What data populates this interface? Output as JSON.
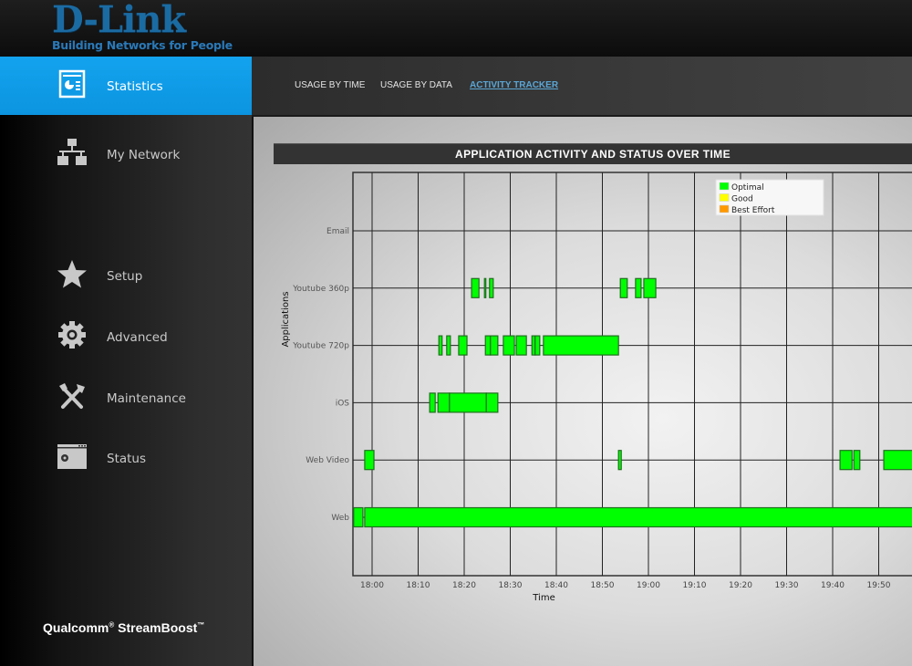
{
  "header": {
    "logo_text": "D-Link",
    "tagline": "Building Networks for People"
  },
  "sidebar": {
    "items": [
      {
        "label": "Statistics",
        "icon": "statistics-icon",
        "active": true
      },
      {
        "label": "My Network",
        "icon": "network-icon",
        "active": false
      },
      {
        "label": "Setup",
        "icon": "star-icon",
        "active": false
      },
      {
        "label": "Advanced",
        "icon": "gear-icon",
        "active": false
      },
      {
        "label": "Maintenance",
        "icon": "tools-icon",
        "active": false
      },
      {
        "label": "Status",
        "icon": "status-window-icon",
        "active": false
      }
    ],
    "brand": {
      "name1": "Qualcomm",
      "reg": "®",
      "name2": " StreamBoost",
      "tm": "™"
    }
  },
  "subnav": {
    "tabs": [
      {
        "label": "USAGE BY TIME",
        "active": false
      },
      {
        "label": "USAGE BY DATA",
        "active": false
      },
      {
        "label": "ACTIVITY TRACKER",
        "active": true
      }
    ]
  },
  "colors": {
    "optimal": "#00ff00",
    "good": "#ffff00",
    "best_effort": "#ff9900",
    "accent": "#0c9de6"
  },
  "chart_data": {
    "type": "timeline",
    "title": "APPLICATION ACTIVITY AND STATUS OVER TIME",
    "xlabel": "Time",
    "ylabel": "Applications",
    "xlim": [
      "17:56",
      "20:00"
    ],
    "x_ticks": [
      "18:00",
      "18:10",
      "18:20",
      "18:30",
      "18:40",
      "18:50",
      "19:00",
      "19:10",
      "19:20",
      "19:30",
      "19:40",
      "19:50"
    ],
    "grid": true,
    "legend_position": "top-right",
    "legend": [
      {
        "label": "Optimal",
        "status": "optimal"
      },
      {
        "label": "Good",
        "status": "good"
      },
      {
        "label": "Best Effort",
        "status": "best_effort"
      }
    ],
    "categories": [
      "Email",
      "Youtube 360p",
      "Youtube 720p",
      "iOS",
      "Web Video",
      "Web"
    ],
    "series": [
      {
        "name": "Email",
        "segments": []
      },
      {
        "name": "Youtube 360p",
        "segments": [
          {
            "start": "18:21.6",
            "end": "18:23.2",
            "status": "optimal"
          },
          {
            "start": "18:24.4",
            "end": "18:24.6",
            "status": "optimal"
          },
          {
            "start": "18:25.5",
            "end": "18:26.3",
            "status": "optimal"
          },
          {
            "start": "18:53.9",
            "end": "18:55.4",
            "status": "optimal"
          },
          {
            "start": "18:57.2",
            "end": "18:58.4",
            "status": "optimal"
          },
          {
            "start": "18:59.0",
            "end": "19:01.6",
            "status": "optimal"
          }
        ]
      },
      {
        "name": "Youtube 720p",
        "segments": [
          {
            "start": "18:14.5",
            "end": "18:15.2",
            "status": "optimal"
          },
          {
            "start": "18:16.2",
            "end": "18:17.0",
            "status": "optimal"
          },
          {
            "start": "18:18.8",
            "end": "18:20.6",
            "status": "optimal"
          },
          {
            "start": "18:24.6",
            "end": "18:25.7",
            "status": "optimal"
          },
          {
            "start": "18:25.7",
            "end": "18:27.3",
            "status": "optimal"
          },
          {
            "start": "18:28.5",
            "end": "18:30.9",
            "status": "optimal"
          },
          {
            "start": "18:31.3",
            "end": "18:33.5",
            "status": "optimal"
          },
          {
            "start": "18:34.7",
            "end": "18:35.4",
            "status": "optimal"
          },
          {
            "start": "18:35.4",
            "end": "18:36.4",
            "status": "optimal"
          },
          {
            "start": "18:37.2",
            "end": "18:53.5",
            "status": "optimal"
          }
        ]
      },
      {
        "name": "iOS",
        "segments": [
          {
            "start": "18:12.5",
            "end": "18:13.7",
            "status": "optimal"
          },
          {
            "start": "18:14.3",
            "end": "18:16.8",
            "status": "optimal"
          },
          {
            "start": "18:16.8",
            "end": "18:24.8",
            "status": "optimal"
          },
          {
            "start": "18:24.8",
            "end": "18:27.3",
            "status": "optimal"
          }
        ]
      },
      {
        "name": "Web Video",
        "segments": [
          {
            "start": "17:58.4",
            "end": "18:00.4",
            "status": "optimal"
          },
          {
            "start": "18:53.5",
            "end": "18:54.1",
            "status": "optimal"
          },
          {
            "start": "19:41.6",
            "end": "19:44.2",
            "status": "optimal"
          },
          {
            "start": "19:44.6",
            "end": "19:45.9",
            "status": "optimal"
          },
          {
            "start": "19:51.1",
            "end": "19:59.0",
            "status": "optimal"
          }
        ]
      },
      {
        "name": "Web",
        "segments": [
          {
            "start": "17:56.0",
            "end": "17:58.0",
            "status": "optimal"
          },
          {
            "start": "17:58.4",
            "end": "19:59.0",
            "status": "optimal"
          }
        ]
      }
    ]
  }
}
